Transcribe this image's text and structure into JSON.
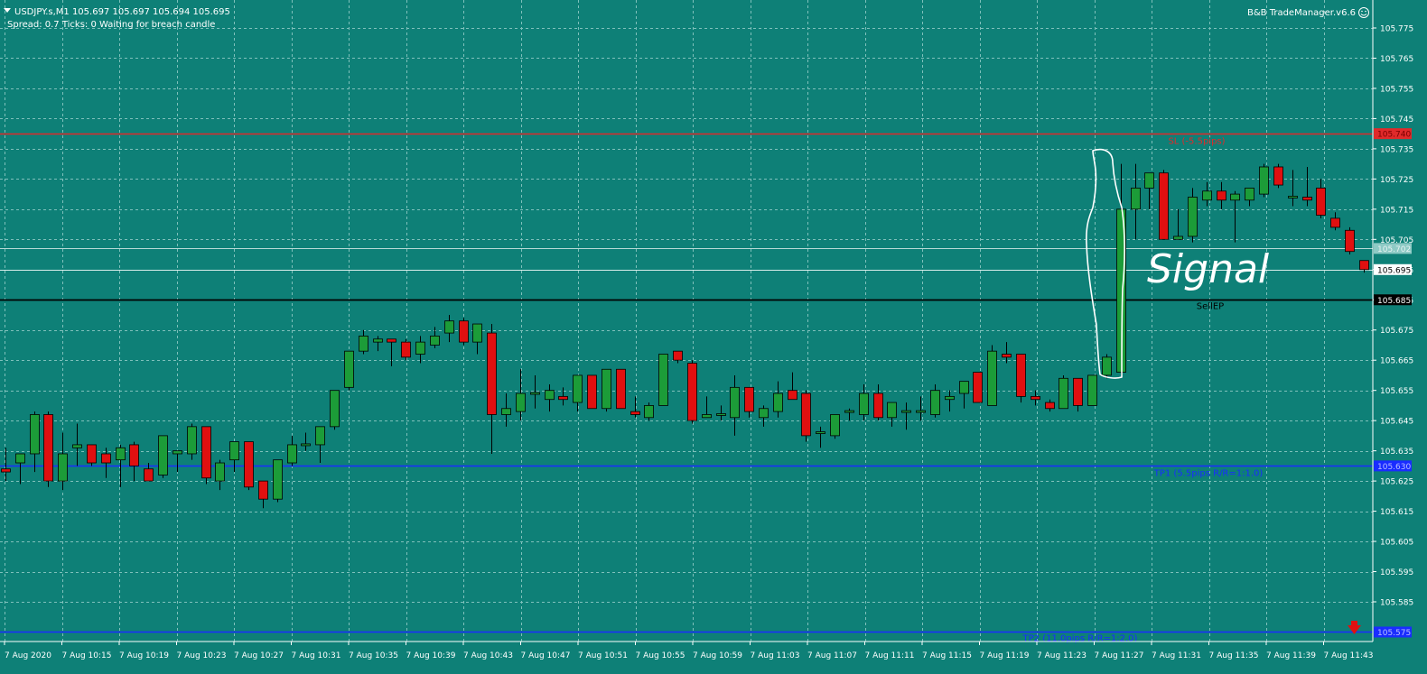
{
  "header": {
    "symbol_line": "USDJPY.s,M1  105.697 105.697 105.694 105.695",
    "status_line": "Spread: 0.7   Ticks: 0   Waiting for breach candle",
    "ea_name": "B&B TradeManager.v6.6"
  },
  "annotation": {
    "handwritten_text": "Signal"
  },
  "colors": {
    "background": "#0e8077",
    "bull": "#1c9c38",
    "bear": "#e01010",
    "sl": "#e02a2a",
    "tp": "#1a2cff",
    "entry": "#000000",
    "grid": "#7fc0bb"
  },
  "icons": {
    "sell_arrow": "down-arrow-icon",
    "smiley": "smiley-icon"
  },
  "chart_data": {
    "type": "candlestick",
    "symbol": "USDJPY.s",
    "timeframe": "M1",
    "ylim": [
      105.57,
      105.785
    ],
    "y_ticks": [
      "105.775",
      "105.765",
      "105.755",
      "105.745",
      "105.735",
      "105.725",
      "105.715",
      "105.705",
      "105.695",
      "105.685",
      "105.675",
      "105.665",
      "105.655",
      "105.645",
      "105.635",
      "105.625",
      "105.615",
      "105.605",
      "105.595",
      "105.585"
    ],
    "x_labels": [
      "7 Aug 2020",
      "7 Aug 10:15",
      "7 Aug 10:19",
      "7 Aug 10:23",
      "7 Aug 10:27",
      "7 Aug 10:31",
      "7 Aug 10:35",
      "7 Aug 10:39",
      "7 Aug 10:43",
      "7 Aug 10:47",
      "7 Aug 10:51",
      "7 Aug 10:55",
      "7 Aug 10:59",
      "7 Aug 11:03",
      "7 Aug 11:07",
      "7 Aug 11:11",
      "7 Aug 11:15",
      "7 Aug 11:19",
      "7 Aug 11:23",
      "7 Aug 11:27",
      "7 Aug 11:31",
      "7 Aug 11:35",
      "7 Aug 11:39",
      "7 Aug 11:43"
    ],
    "candles": [
      {
        "o": 105.629,
        "h": 105.636,
        "l": 105.625,
        "c": 105.628
      },
      {
        "o": 105.631,
        "h": 105.634,
        "l": 105.624,
        "c": 105.634
      },
      {
        "o": 105.634,
        "h": 105.648,
        "l": 105.628,
        "c": 105.647
      },
      {
        "o": 105.647,
        "h": 105.648,
        "l": 105.623,
        "c": 105.625
      },
      {
        "o": 105.625,
        "h": 105.641,
        "l": 105.622,
        "c": 105.634
      },
      {
        "o": 105.636,
        "h": 105.644,
        "l": 105.63,
        "c": 105.637
      },
      {
        "o": 105.637,
        "h": 105.637,
        "l": 105.63,
        "c": 105.631
      },
      {
        "o": 105.634,
        "h": 105.636,
        "l": 105.626,
        "c": 105.631
      },
      {
        "o": 105.632,
        "h": 105.637,
        "l": 105.623,
        "c": 105.636
      },
      {
        "o": 105.637,
        "h": 105.638,
        "l": 105.625,
        "c": 105.63
      },
      {
        "o": 105.629,
        "h": 105.631,
        "l": 105.625,
        "c": 105.625
      },
      {
        "o": 105.627,
        "h": 105.64,
        "l": 105.626,
        "c": 105.64
      },
      {
        "o": 105.634,
        "h": 105.635,
        "l": 105.628,
        "c": 105.635
      },
      {
        "o": 105.634,
        "h": 105.644,
        "l": 105.632,
        "c": 105.643
      },
      {
        "o": 105.643,
        "h": 105.643,
        "l": 105.624,
        "c": 105.626
      },
      {
        "o": 105.625,
        "h": 105.632,
        "l": 105.622,
        "c": 105.631
      },
      {
        "o": 105.632,
        "h": 105.638,
        "l": 105.628,
        "c": 105.638
      },
      {
        "o": 105.638,
        "h": 105.638,
        "l": 105.622,
        "c": 105.623
      },
      {
        "o": 105.625,
        "h": 105.625,
        "l": 105.616,
        "c": 105.619
      },
      {
        "o": 105.619,
        "h": 105.632,
        "l": 105.618,
        "c": 105.632
      },
      {
        "o": 105.631,
        "h": 105.64,
        "l": 105.63,
        "c": 105.637
      },
      {
        "o": 105.637,
        "h": 105.641,
        "l": 105.635,
        "c": 105.637
      },
      {
        "o": 105.637,
        "h": 105.643,
        "l": 105.631,
        "c": 105.643
      },
      {
        "o": 105.643,
        "h": 105.655,
        "l": 105.642,
        "c": 105.655
      },
      {
        "o": 105.656,
        "h": 105.668,
        "l": 105.655,
        "c": 105.668
      },
      {
        "o": 105.668,
        "h": 105.675,
        "l": 105.667,
        "c": 105.673
      },
      {
        "o": 105.671,
        "h": 105.673,
        "l": 105.668,
        "c": 105.672
      },
      {
        "o": 105.672,
        "h": 105.672,
        "l": 105.663,
        "c": 105.671
      },
      {
        "o": 105.671,
        "h": 105.672,
        "l": 105.665,
        "c": 105.666
      },
      {
        "o": 105.667,
        "h": 105.673,
        "l": 105.664,
        "c": 105.671
      },
      {
        "o": 105.67,
        "h": 105.676,
        "l": 105.669,
        "c": 105.673
      },
      {
        "o": 105.674,
        "h": 105.68,
        "l": 105.671,
        "c": 105.678
      },
      {
        "o": 105.678,
        "h": 105.679,
        "l": 105.67,
        "c": 105.671
      },
      {
        "o": 105.671,
        "h": 105.677,
        "l": 105.667,
        "c": 105.677
      },
      {
        "o": 105.674,
        "h": 105.677,
        "l": 105.634,
        "c": 105.647
      },
      {
        "o": 105.647,
        "h": 105.654,
        "l": 105.643,
        "c": 105.649
      },
      {
        "o": 105.648,
        "h": 105.662,
        "l": 105.645,
        "c": 105.654
      },
      {
        "o": 105.654,
        "h": 105.66,
        "l": 105.649,
        "c": 105.654
      },
      {
        "o": 105.652,
        "h": 105.657,
        "l": 105.648,
        "c": 105.655
      },
      {
        "o": 105.653,
        "h": 105.656,
        "l": 105.65,
        "c": 105.652
      },
      {
        "o": 105.651,
        "h": 105.66,
        "l": 105.648,
        "c": 105.66
      },
      {
        "o": 105.66,
        "h": 105.66,
        "l": 105.649,
        "c": 105.649
      },
      {
        "o": 105.649,
        "h": 105.662,
        "l": 105.648,
        "c": 105.662
      },
      {
        "o": 105.662,
        "h": 105.662,
        "l": 105.649,
        "c": 105.649
      },
      {
        "o": 105.648,
        "h": 105.653,
        "l": 105.646,
        "c": 105.647
      },
      {
        "o": 105.646,
        "h": 105.651,
        "l": 105.645,
        "c": 105.65
      },
      {
        "o": 105.65,
        "h": 105.667,
        "l": 105.65,
        "c": 105.667
      },
      {
        "o": 105.668,
        "h": 105.668,
        "l": 105.664,
        "c": 105.665
      },
      {
        "o": 105.664,
        "h": 105.665,
        "l": 105.644,
        "c": 105.645
      },
      {
        "o": 105.646,
        "h": 105.653,
        "l": 105.646,
        "c": 105.647
      },
      {
        "o": 105.647,
        "h": 105.65,
        "l": 105.645,
        "c": 105.647
      },
      {
        "o": 105.646,
        "h": 105.66,
        "l": 105.64,
        "c": 105.656
      },
      {
        "o": 105.656,
        "h": 105.656,
        "l": 105.646,
        "c": 105.648
      },
      {
        "o": 105.646,
        "h": 105.65,
        "l": 105.643,
        "c": 105.649
      },
      {
        "o": 105.648,
        "h": 105.658,
        "l": 105.646,
        "c": 105.654
      },
      {
        "o": 105.655,
        "h": 105.661,
        "l": 105.654,
        "c": 105.652
      },
      {
        "o": 105.654,
        "h": 105.655,
        "l": 105.638,
        "c": 105.64
      },
      {
        "o": 105.641,
        "h": 105.643,
        "l": 105.636,
        "c": 105.641
      },
      {
        "o": 105.64,
        "h": 105.647,
        "l": 105.639,
        "c": 105.647
      },
      {
        "o": 105.648,
        "h": 105.649,
        "l": 105.645,
        "c": 105.648
      },
      {
        "o": 105.647,
        "h": 105.657,
        "l": 105.645,
        "c": 105.654
      },
      {
        "o": 105.654,
        "h": 105.657,
        "l": 105.645,
        "c": 105.646
      },
      {
        "o": 105.646,
        "h": 105.651,
        "l": 105.643,
        "c": 105.651
      },
      {
        "o": 105.648,
        "h": 105.651,
        "l": 105.642,
        "c": 105.648
      },
      {
        "o": 105.648,
        "h": 105.653,
        "l": 105.645,
        "c": 105.648
      },
      {
        "o": 105.647,
        "h": 105.657,
        "l": 105.646,
        "c": 105.655
      },
      {
        "o": 105.652,
        "h": 105.655,
        "l": 105.648,
        "c": 105.653
      },
      {
        "o": 105.654,
        "h": 105.658,
        "l": 105.649,
        "c": 105.658
      },
      {
        "o": 105.661,
        "h": 105.661,
        "l": 105.651,
        "c": 105.651
      },
      {
        "o": 105.65,
        "h": 105.67,
        "l": 105.65,
        "c": 105.668
      },
      {
        "o": 105.667,
        "h": 105.671,
        "l": 105.664,
        "c": 105.666
      },
      {
        "o": 105.667,
        "h": 105.667,
        "l": 105.651,
        "c": 105.653
      },
      {
        "o": 105.653,
        "h": 105.655,
        "l": 105.65,
        "c": 105.652
      },
      {
        "o": 105.651,
        "h": 105.652,
        "l": 105.648,
        "c": 105.649
      },
      {
        "o": 105.649,
        "h": 105.66,
        "l": 105.649,
        "c": 105.659
      },
      {
        "o": 105.659,
        "h": 105.659,
        "l": 105.648,
        "c": 105.65
      },
      {
        "o": 105.65,
        "h": 105.66,
        "l": 105.65,
        "c": 105.66
      },
      {
        "o": 105.66,
        "h": 105.667,
        "l": 105.659,
        "c": 105.666
      },
      {
        "o": 105.661,
        "h": 105.73,
        "l": 105.66,
        "c": 105.715
      },
      {
        "o": 105.715,
        "h": 105.73,
        "l": 105.705,
        "c": 105.722
      },
      {
        "o": 105.722,
        "h": 105.727,
        "l": 105.715,
        "c": 105.727
      },
      {
        "o": 105.727,
        "h": 105.728,
        "l": 105.705,
        "c": 105.705
      },
      {
        "o": 105.705,
        "h": 105.715,
        "l": 105.705,
        "c": 105.706
      },
      {
        "o": 105.706,
        "h": 105.722,
        "l": 105.704,
        "c": 105.719
      },
      {
        "o": 105.718,
        "h": 105.724,
        "l": 105.716,
        "c": 105.721
      },
      {
        "o": 105.721,
        "h": 105.724,
        "l": 105.715,
        "c": 105.718
      },
      {
        "o": 105.718,
        "h": 105.721,
        "l": 105.704,
        "c": 105.72
      },
      {
        "o": 105.718,
        "h": 105.722,
        "l": 105.716,
        "c": 105.722
      },
      {
        "o": 105.72,
        "h": 105.73,
        "l": 105.719,
        "c": 105.729
      },
      {
        "o": 105.729,
        "h": 105.73,
        "l": 105.722,
        "c": 105.723
      },
      {
        "o": 105.719,
        "h": 105.728,
        "l": 105.716,
        "c": 105.719
      },
      {
        "o": 105.719,
        "h": 105.729,
        "l": 105.716,
        "c": 105.718
      },
      {
        "o": 105.722,
        "h": 105.725,
        "l": 105.712,
        "c": 105.713
      },
      {
        "o": 105.712,
        "h": 105.714,
        "l": 105.708,
        "c": 105.709
      },
      {
        "o": 105.708,
        "h": 105.709,
        "l": 105.7,
        "c": 105.701
      },
      {
        "o": 105.698,
        "h": 105.698,
        "l": 105.694,
        "c": 105.695
      }
    ],
    "levels": [
      {
        "name": "SL",
        "price": 105.74,
        "price_label": "105.740",
        "text": "SL (-5.5pips)",
        "color": "#e02a2a"
      },
      {
        "name": "SellEP",
        "price": 105.685,
        "price_label": "105.685",
        "text": "SellEP",
        "color": "#000000"
      },
      {
        "name": "TP1",
        "price": 105.63,
        "price_label": "105.630",
        "text": "TP1 (5.5pips R/R=1:1.0)",
        "color": "#1a2cff"
      },
      {
        "name": "TP2",
        "price": 105.575,
        "price_label": "105.575",
        "text": "TP2 (11.0pips R/R=1:2.0)",
        "color": "#1a2cff"
      }
    ],
    "ask": {
      "price": 105.702,
      "label": "105.702"
    },
    "bid": {
      "price": 105.695,
      "label": "105.695"
    }
  }
}
